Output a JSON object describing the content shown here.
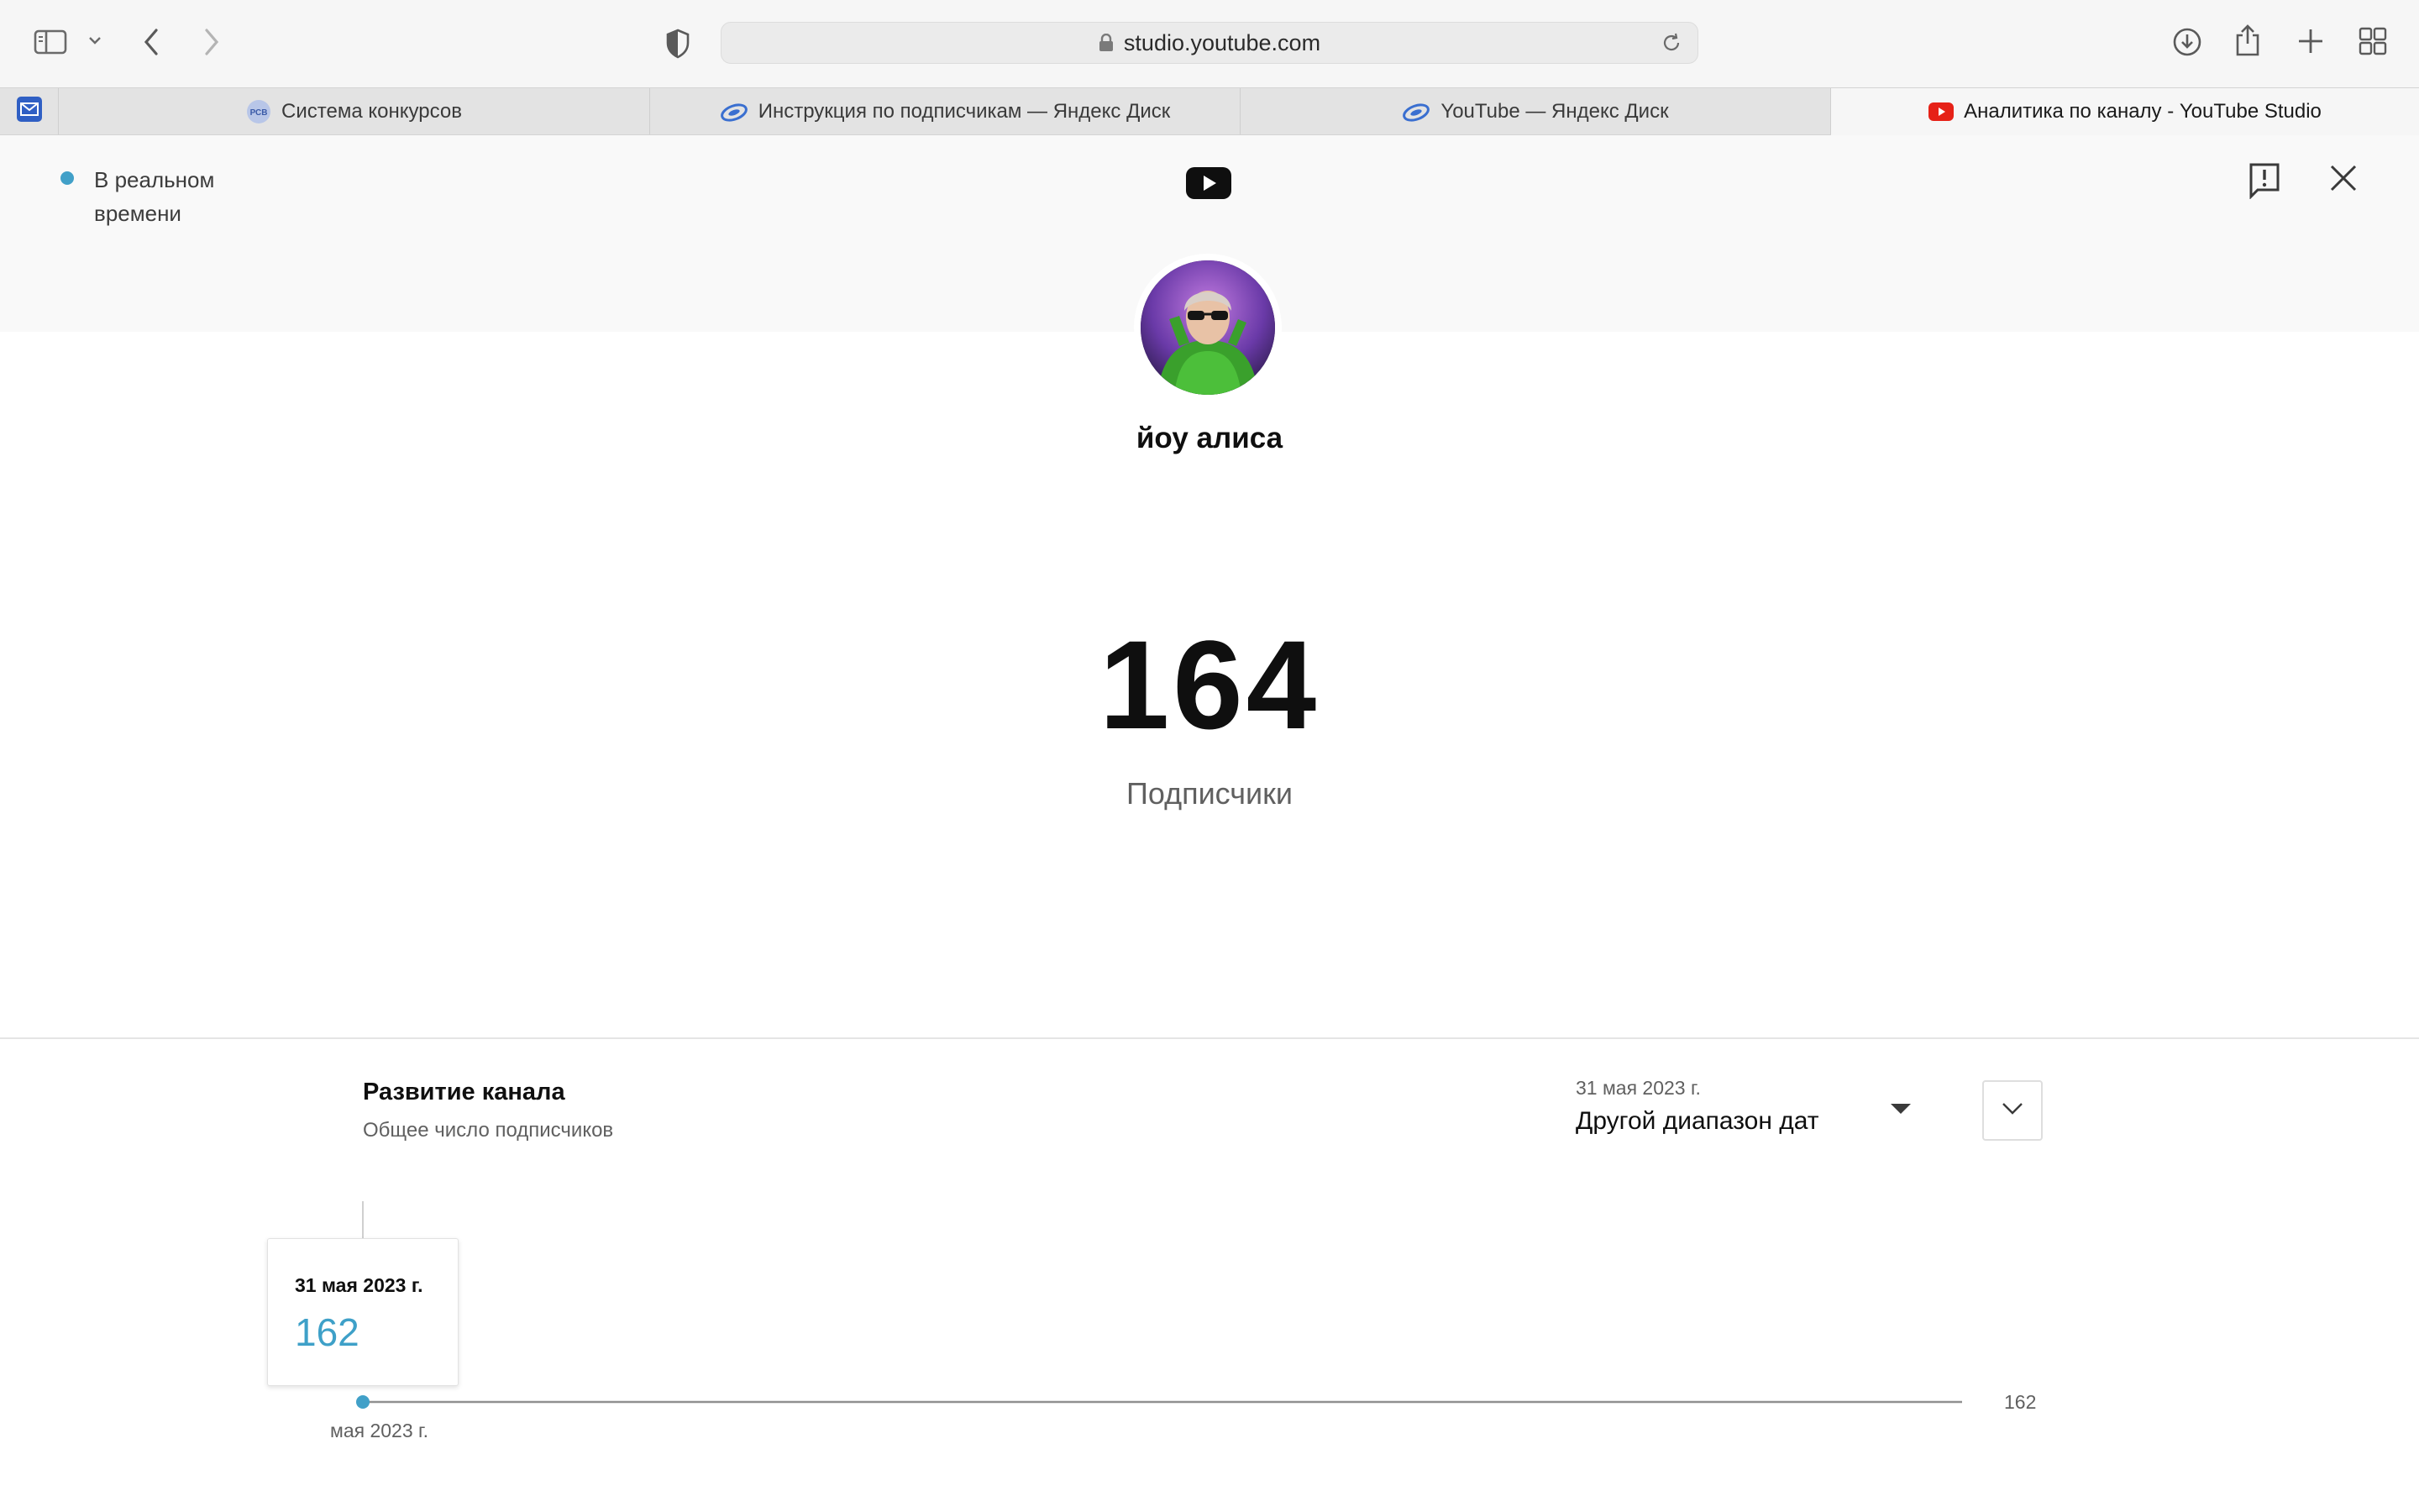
{
  "browser": {
    "url": "studio.youtube.com",
    "tabs": [
      {
        "label": "Система конкурсов",
        "icon": "ccb-favicon-icon",
        "active": false
      },
      {
        "label": "Инструкция по подписчикам — Яндекс Диск",
        "icon": "yandex-disk-icon",
        "active": false
      },
      {
        "label": "YouTube — Яндекс Диск",
        "icon": "yandex-disk-icon",
        "active": false
      },
      {
        "label": "Аналитика по каналу - YouTube Studio",
        "icon": "youtube-favicon-icon",
        "active": true
      }
    ]
  },
  "realtime": {
    "status_label": "В реальном времени",
    "status_color": "#41a0c8"
  },
  "channel": {
    "name": "йоу алиса",
    "subscribers": "164",
    "subscribers_label": "Подписчики"
  },
  "growth": {
    "title": "Развитие канала",
    "subtitle": "Общее число подписчиков",
    "range_date": "31 мая 2023 г.",
    "range_name": "Другой диапазон дат"
  },
  "tooltip": {
    "date": "31 мая 2023 г.",
    "value": "162"
  },
  "chart_data": {
    "type": "line",
    "x": [
      "31 мая 2023 г."
    ],
    "series": [
      {
        "values": [
          162
        ]
      }
    ],
    "x_tick_labels": [
      "мая 2023 г."
    ],
    "y_tick_labels": [
      "162"
    ],
    "line_color": "#909090",
    "point_color": "#41a0c8"
  }
}
